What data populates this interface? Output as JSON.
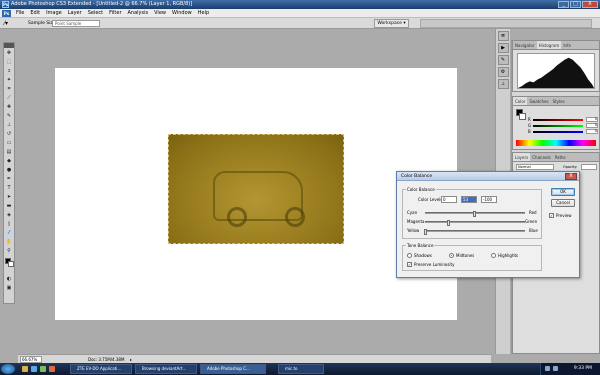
{
  "window": {
    "title": "Adobe Photoshop CS3 Extended - [Untitled-2 @ 66.7% (Layer 1, RGB/8)]",
    "app_badge": "Ps",
    "btn_min": "_",
    "btn_max": "□",
    "btn_close": "X"
  },
  "menubar": {
    "logo": "Ps",
    "items": [
      "File",
      "Edit",
      "Image",
      "Layer",
      "Select",
      "Filter",
      "Analysis",
      "View",
      "Window",
      "Help"
    ]
  },
  "options": {
    "sample_size_label": "Sample Size:",
    "sample_size_value": "Point Sample",
    "workspace_label": "Workspace ▾"
  },
  "status": {
    "zoom": "66.67%",
    "doc_info": "Doc: 3.75M/4.38M",
    "arrow": "▸"
  },
  "panels": {
    "histogram_tabs": [
      "Navigator",
      "Histogram",
      "Info"
    ],
    "color_tabs": [
      "Color",
      "Swatches",
      "Styles"
    ],
    "color_channels": [
      "R",
      "G",
      "B"
    ],
    "color_values": [
      "0",
      "0",
      "0"
    ],
    "layers_tabs": [
      "Layers",
      "Channels",
      "Paths"
    ],
    "blend_mode": "Normal",
    "opacity_label": "Opacity:"
  },
  "color_balance": {
    "title": "Color Balance",
    "close_label": "X",
    "group1": "Color Balance",
    "levels_label": "Color Levels:",
    "level_values": [
      "0",
      "53",
      "-100"
    ],
    "sliders": [
      {
        "left": "Cyan",
        "right": "Red",
        "value": 0
      },
      {
        "left": "Magenta",
        "right": "Green",
        "value": 53
      },
      {
        "left": "Yellow",
        "right": "Blue",
        "value": -100
      }
    ],
    "group2": "Tone Balance",
    "tones": [
      "Shadows",
      "Midtones",
      "Highlights"
    ],
    "selected_tone": "Midtones",
    "preserve_luminosity": "Preserve Luminosity",
    "preserve_checked": true,
    "ok": "OK",
    "cancel": "Cancel",
    "preview": "Preview",
    "preview_checked": true
  },
  "taskbar": {
    "items": [
      "ZTE EV-DO Applicati...",
      "Browsing deviantArt...",
      "Adobe Photoshop C...",
      "mic.to"
    ],
    "active_index": 2,
    "time": "9:33 PM"
  },
  "colors": {
    "title_bar": "#1b3d6d",
    "photo_tint": "#9d8121",
    "dialog_accent": "#3d6cc2"
  }
}
